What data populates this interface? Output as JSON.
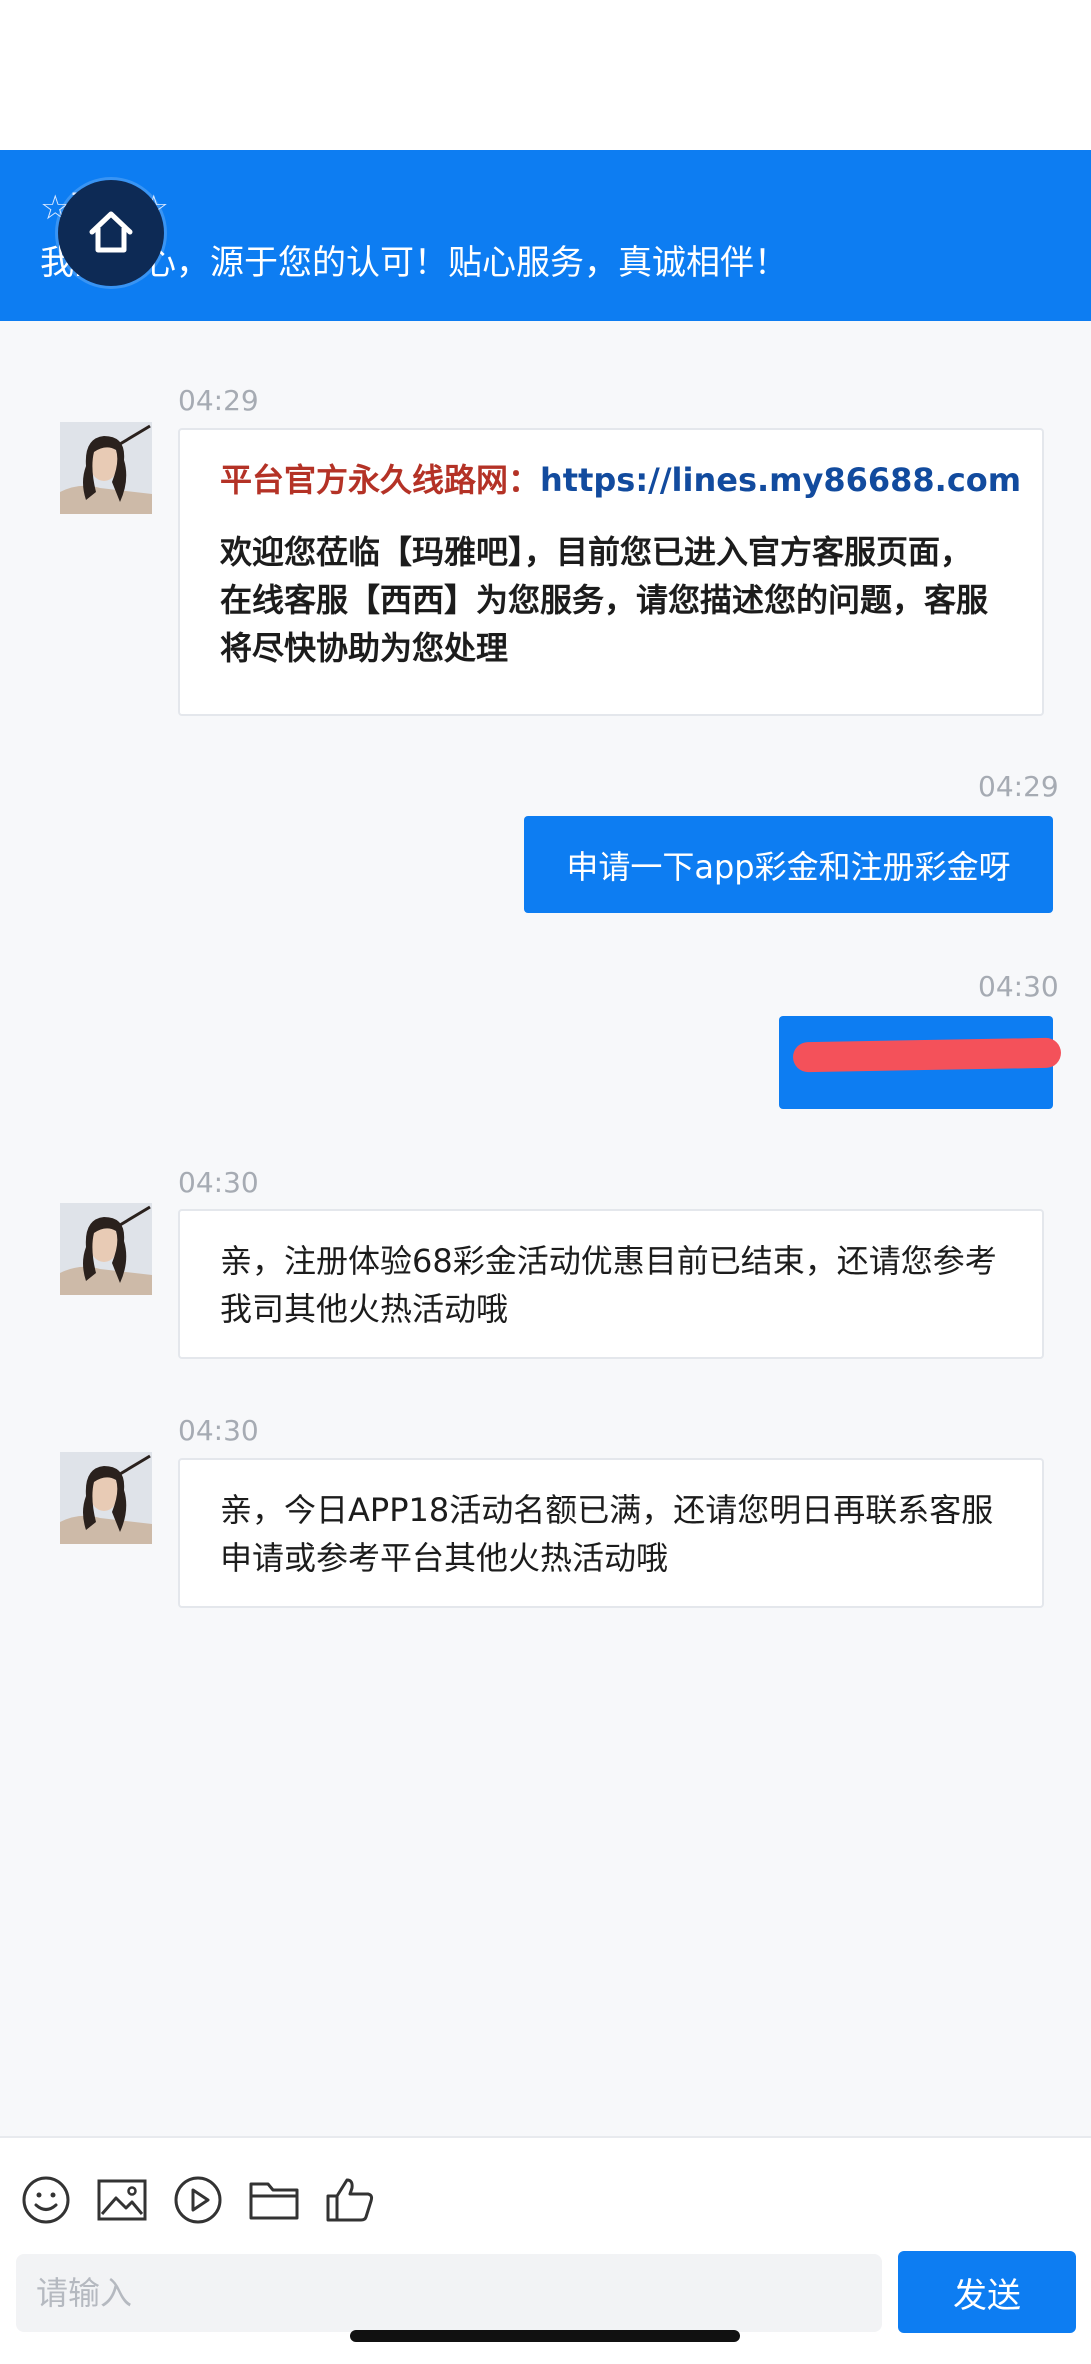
{
  "header": {
    "title": "☆西西☆",
    "slogan": "我的开心，源于您的认可！贴心服务，真诚相伴！",
    "bg_color": "#0d7df2"
  },
  "home_button": {
    "icon": "home-icon"
  },
  "messages": [
    {
      "direction": "incoming",
      "time": "04:29",
      "avatar": "agent-avatar",
      "prefix": "平台官方永久线路网：",
      "link": "https://lines.my86688.com",
      "text": "欢迎您莅临【玛雅吧】，目前您已进入官方客服页面，在线客服【西西】为您服务，请您描述您的问题，客服将尽快协助为您处理"
    },
    {
      "direction": "outgoing",
      "time": "04:29",
      "text": "申请一下app彩金和注册彩金呀"
    },
    {
      "direction": "outgoing",
      "time": "04:30",
      "text": "[redacted]"
    },
    {
      "direction": "incoming",
      "time": "04:30",
      "avatar": "agent-avatar",
      "text": "亲，注册体验68彩金活动优惠目前已结束，还请您参考我司其他火热活动哦"
    },
    {
      "direction": "incoming",
      "time": "04:30",
      "avatar": "agent-avatar",
      "text": "亲，今日APP18活动名额已满，还请您明日再联系客服申请或参考平台其他火热活动哦"
    }
  ],
  "toolbar": {
    "icons": [
      "emoji-icon",
      "image-icon",
      "video-icon",
      "folder-icon",
      "thumbs-up-icon"
    ],
    "input_placeholder": "请输入",
    "send_label": "发送"
  }
}
